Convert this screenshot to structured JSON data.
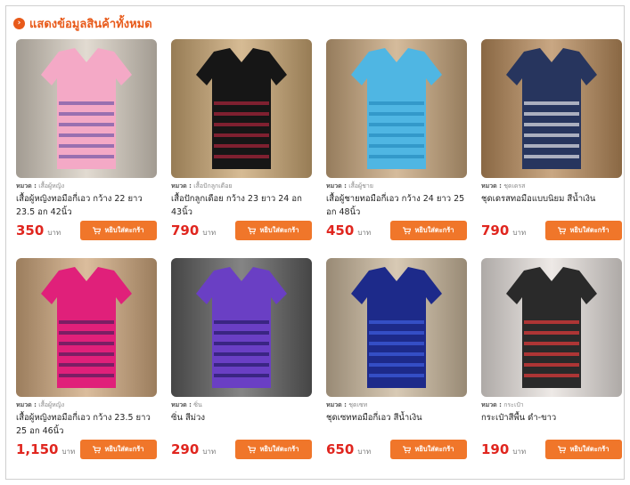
{
  "section": {
    "title": "แสดงข้อมูลสินค้าทั้งหมด"
  },
  "labels": {
    "category_prefix": "หมวด :",
    "currency": "บาท",
    "add_to_cart": "หยิบใส่ตะกร้า"
  },
  "products": [
    {
      "category": "เสื้อผู้หญิง",
      "name": "เสื้อผู้หญิงทอมือกี่เอว กว้าง 22 ยาว 23.5 อก 42นิ้ว",
      "price": "350",
      "colors": {
        "bg": "#d8cfc2",
        "garment": "#f4a9c6",
        "pattern": "#7b5ea8"
      }
    },
    {
      "category": "เสื้อปักลูกเดือย",
      "name": "เสื้อปักลูกเดือย กว้าง 23 ยาว 24 อก 43นิ้ว",
      "price": "790",
      "colors": {
        "bg": "#c9a571",
        "garment": "#161616",
        "pattern": "#a3243a"
      }
    },
    {
      "category": "เสื้อผู้ชาย",
      "name": "เสื้อผู้ชายทอมือกี่เอว กว้าง 24 ยาว 25 อก 48นิ้ว",
      "price": "450",
      "colors": {
        "bg": "#c7a57b",
        "garment": "#4fb6e3",
        "pattern": "#2a8fc2"
      }
    },
    {
      "category": "ชุดเดรส",
      "name": "ชุดเดรสทอมือแบบนิยม สีน้ำเงิน",
      "price": "790",
      "colors": {
        "bg": "#b78a5a",
        "garment": "#27355e",
        "pattern": "#d8d8e0"
      }
    },
    {
      "category": "เสื้อผู้หญิง",
      "name": "เสื้อผู้หญิงทอมือกี่เอว กว้าง 23.5 ยาว 25 อก 46นิ้ว",
      "price": "1,150",
      "colors": {
        "bg": "#cfa77c",
        "garment": "#e0207a",
        "pattern": "#5a1e5e"
      }
    },
    {
      "category": "ซิ่น",
      "name": "ซิ่น สีม่วง",
      "price": "290",
      "colors": {
        "bg": "#5c5c5c",
        "garment": "#6a3fc4",
        "pattern": "#2b1e6e"
      }
    },
    {
      "category": "ชุดเซท",
      "name": "ชุดเซททอมือกี่เอว สีน้ำเงิน",
      "price": "650",
      "colors": {
        "bg": "#cbb89c",
        "garment": "#1d2a8a",
        "pattern": "#3c5bd8"
      }
    },
    {
      "category": "กระเป๋า",
      "name": "กระเป๋าสีพื้น ดำ-ขาว",
      "price": "190",
      "colors": {
        "bg": "#e8e2de",
        "garment": "#2a2a2a",
        "pattern": "#d93a3a"
      }
    }
  ]
}
